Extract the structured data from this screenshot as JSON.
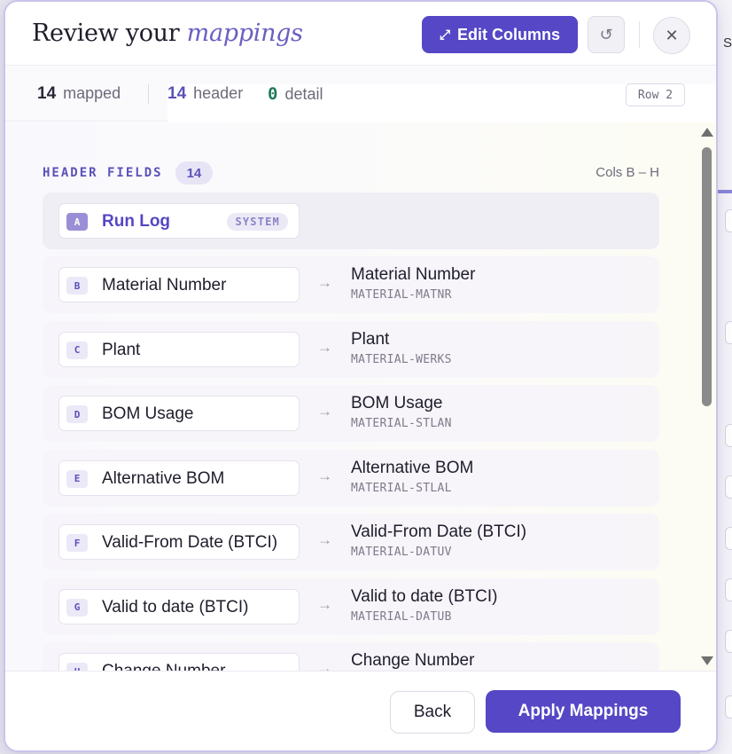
{
  "background": {
    "partial_text": "S"
  },
  "header": {
    "title_plain": "Review your",
    "title_accent": "mappings",
    "edit_button_label": "Edit Columns",
    "edit_icon": "expand-icon",
    "reset_icon": "undo-icon",
    "close_icon": "close-icon"
  },
  "stats": {
    "mapped_count": "14",
    "mapped_label": "mapped",
    "header_count": "14",
    "header_label": "header",
    "detail_count": "0",
    "detail_label": "detail",
    "row_badge": "Row 2"
  },
  "section": {
    "title": "HEADER FIELDS",
    "count": "14",
    "cols_range": "Cols B – H"
  },
  "system_row": {
    "letter": "A",
    "label": "Run Log",
    "badge": "SYSTEM"
  },
  "rows": [
    {
      "letter": "B",
      "source": "Material Number",
      "target": "Material Number",
      "code": "MATERIAL-MATNR"
    },
    {
      "letter": "C",
      "source": "Plant",
      "target": "Plant",
      "code": "MATERIAL-WERKS"
    },
    {
      "letter": "D",
      "source": "BOM Usage",
      "target": "BOM Usage",
      "code": "MATERIAL-STLAN"
    },
    {
      "letter": "E",
      "source": "Alternative BOM",
      "target": "Alternative BOM",
      "code": "MATERIAL-STLAL"
    },
    {
      "letter": "F",
      "source": "Valid-From Date (BTCI)",
      "target": "Valid-From Date (BTCI)",
      "code": "MATERIAL-DATUV"
    },
    {
      "letter": "G",
      "source": "Valid to date (BTCI)",
      "target": "Valid to date (BTCI)",
      "code": "MATERIAL-DATUB"
    },
    {
      "letter": "H",
      "source": "Change Number",
      "target": "Change Number",
      "code": ""
    }
  ],
  "arrow_glyph": "→",
  "footer": {
    "back_label": "Back",
    "apply_label": "Apply Mappings"
  },
  "colors": {
    "accent": "#5547c5",
    "accent_text": "#5b52b8",
    "detail_green": "#1f7a5a"
  }
}
